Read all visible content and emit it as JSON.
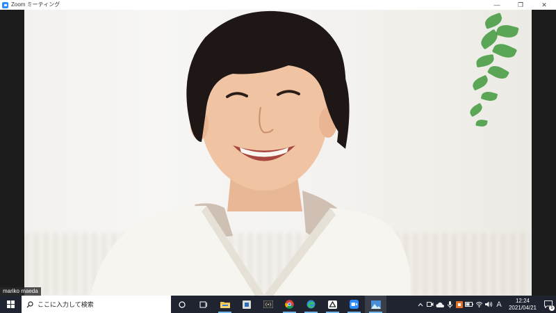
{
  "window": {
    "title": "Zoom ミーティング",
    "controls": {
      "minimize": "—",
      "restore": "❐",
      "close": "✕"
    }
  },
  "participant": {
    "name": "mariko maeda"
  },
  "taskbar": {
    "search_placeholder": "ここに入力して検索",
    "pinned_apps": [
      {
        "name": "task-view-icon",
        "active": false
      },
      {
        "name": "file-explorer-icon",
        "active": true
      },
      {
        "name": "snip-tool-icon",
        "active": false
      },
      {
        "name": "media-app-icon",
        "active": false
      },
      {
        "name": "chrome-icon",
        "active": true
      },
      {
        "name": "edge-icon",
        "active": true
      },
      {
        "name": "drive-icon",
        "active": true
      },
      {
        "name": "zoom-icon",
        "active": true
      },
      {
        "name": "photos-icon",
        "active": true
      }
    ],
    "tray": {
      "ime_label": "A",
      "time": "12:24",
      "date": "2021/04/21",
      "notification_count": "5"
    }
  },
  "colors": {
    "taskbar_bg": "#1f2430",
    "zoom_blue": "#2D8CFF",
    "active_indicator": "#76b9ed"
  }
}
